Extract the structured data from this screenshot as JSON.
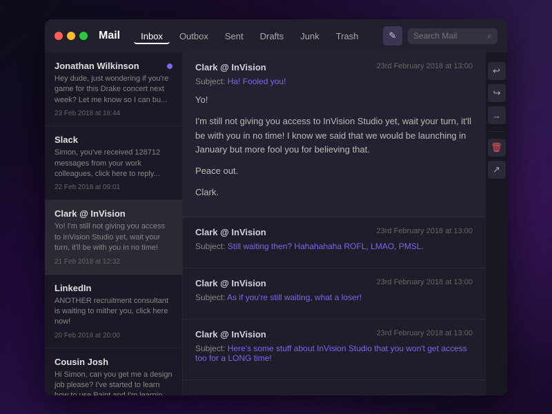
{
  "app": {
    "title": "Mail",
    "window_controls": {
      "red": "close",
      "yellow": "minimize",
      "green": "maximize"
    }
  },
  "nav": {
    "tabs": [
      {
        "id": "inbox",
        "label": "Inbox",
        "active": true
      },
      {
        "id": "outbox",
        "label": "Outbox",
        "active": false
      },
      {
        "id": "sent",
        "label": "Sent",
        "active": false
      },
      {
        "id": "drafts",
        "label": "Drafts",
        "active": false
      },
      {
        "id": "junk",
        "label": "Junk",
        "active": false
      },
      {
        "id": "trash",
        "label": "Trash",
        "active": false
      }
    ],
    "compose_label": "✎",
    "search_placeholder": "Search Mail"
  },
  "email_list": [
    {
      "id": "1",
      "sender": "Jonathan Wilkinson",
      "preview": "Hey dude, just wondering if you're game for this Drake concert next week? Let me know so I can bu...",
      "date": "23 Feb 2018 at 16:44",
      "unread": true,
      "active": false
    },
    {
      "id": "2",
      "sender": "Slack",
      "preview": "Simon, you've received 128712 messages from your work colleagues, click here to reply...",
      "date": "22 Feb 2018 at 09:01",
      "unread": false,
      "active": false
    },
    {
      "id": "3",
      "sender": "Clark @ InVision",
      "preview": "Yo! I'm still not giving you access to InVision Studio yet, wait your turn, it'll be with you in no time!",
      "date": "21 Feb 2018 at 12:32",
      "unread": false,
      "active": true
    },
    {
      "id": "4",
      "sender": "LinkedIn",
      "preview": "ANOTHER recruitment consultant is waiting to mither you, click here now!",
      "date": "20 Feb 2018 at 20:00",
      "unread": false,
      "active": false
    },
    {
      "id": "5",
      "sender": "Cousin Josh",
      "preview": "Hi Simon, can you get me a design job please? I've started to learn how to use Paint and I'm learnin...",
      "date": "",
      "unread": false,
      "active": false
    }
  ],
  "email_thread": {
    "items": [
      {
        "id": "t1",
        "sender": "Clark @ InVision",
        "date": "23rd February 2018 at 13:00",
        "subject_prefix": "Subject:",
        "subject": "Ha! Fooled you!",
        "subject_color": true,
        "expanded": true,
        "body_lines": [
          "Yo!",
          "I'm still not giving you access to InVision Studio yet, wait your turn, it'll be with you in no time! I know we said that we would be launching in January but more fool you for believing that.",
          "Peace out.",
          "Clark."
        ]
      },
      {
        "id": "t2",
        "sender": "Clark @ InVision",
        "date": "23rd February 2018 at 13:00",
        "subject_prefix": "Subject:",
        "subject": "Still waiting then? Hahahahaha ROFL, LMAO, PMSL.",
        "subject_color": true,
        "expanded": false,
        "body_lines": []
      },
      {
        "id": "t3",
        "sender": "Clark @ InVision",
        "date": "23rd February 2018 at 13:00",
        "subject_prefix": "Subject:",
        "subject": "As if you're still waiting, what a loser!",
        "subject_color": true,
        "expanded": false,
        "body_lines": []
      },
      {
        "id": "t4",
        "sender": "Clark @ InVision",
        "date": "23rd February 2018 at 13:00",
        "subject_prefix": "Subject:",
        "subject": "Here's some stuff about InVision Studio that you won't get access too for a LONG time!",
        "subject_color": true,
        "expanded": false,
        "body_lines": []
      }
    ]
  },
  "actions": {
    "reply": "↩",
    "reply_all": "↩",
    "forward": "→",
    "delete": "🗑",
    "move": "↗"
  },
  "colors": {
    "accent": "#7b68ee",
    "danger": "#e55555"
  }
}
